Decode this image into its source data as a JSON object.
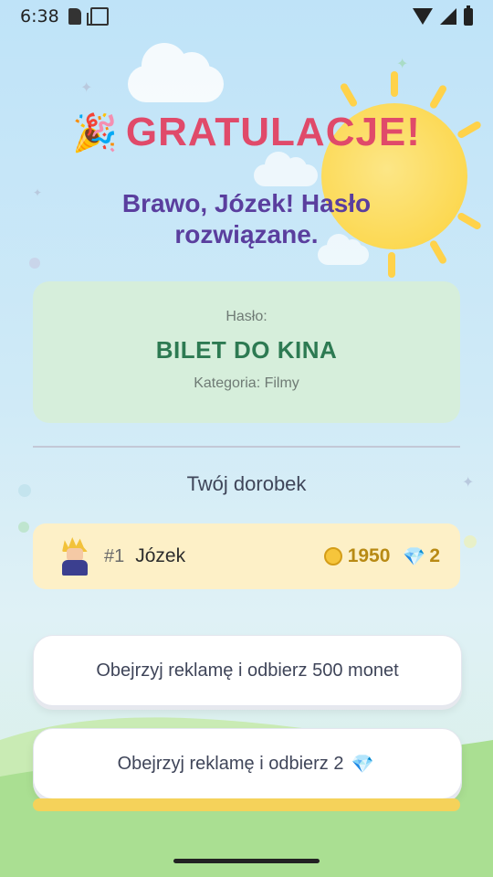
{
  "status_bar": {
    "time": "6:38"
  },
  "header": {
    "party_emoji": "🎉",
    "title": "GRATULACJE!",
    "subtitle": "Brawo, Józek! Hasło rozwiązane."
  },
  "answer_card": {
    "label": "Hasło:",
    "answer": "BILET DO KINA",
    "category": "Kategoria: Filmy"
  },
  "results": {
    "section_title": "Twój dorobek",
    "player": {
      "rank": "#1",
      "name": "Józek",
      "coins": "1950",
      "gems": "2"
    }
  },
  "actions": {
    "watch_ad_coins": "Obejrzyj reklamę i odbierz 500 monet",
    "watch_ad_gems": "Obejrzyj reklamę i odbierz 2",
    "gem_glyph": "💎"
  },
  "colors": {
    "title": "#e04a6a",
    "subtitle": "#5a3e9e",
    "answer": "#2d7a52",
    "accent_yellow": "#f5d25a"
  }
}
